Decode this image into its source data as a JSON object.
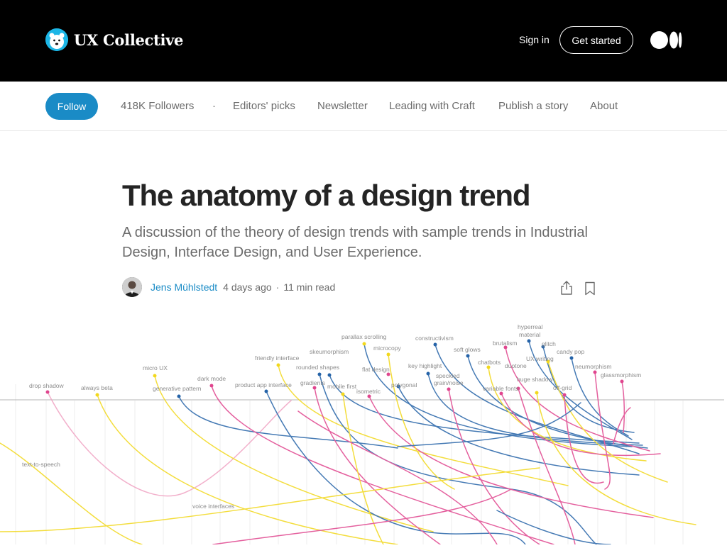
{
  "header": {
    "brand_name": "UX Collective",
    "sign_in": "Sign in",
    "get_started": "Get started"
  },
  "publication_nav": {
    "follow": "Follow",
    "followers": "418K Followers",
    "dot": "·",
    "items": [
      "Editors' picks",
      "Newsletter",
      "Leading with Craft",
      "Publish a story",
      "About"
    ]
  },
  "article": {
    "title": "The anatomy of a design trend",
    "subtitle": "A discussion of the theory of design trends with sample trends in Industrial Design, Interface Design, and User Experience.",
    "author": "Jens Mühlstedt",
    "date": "4 days ago",
    "dot": "·",
    "read_time": "11 min read"
  },
  "hero_chart": {
    "colors": {
      "pink": "#e0458e",
      "yellow": "#f2d81c",
      "blue": "#2563a8",
      "light_pink": "#f0a3c3"
    },
    "labels": [
      "drop shadow",
      "always beta",
      "micro UX",
      "generative pattern",
      "dark mode",
      "friendly interface",
      "product app interface",
      "skeumorphism",
      "rounded shapes",
      "gradients",
      "parallax scrolling",
      "mobile first",
      "microcopy",
      "flat design",
      "isometric",
      "constructivism",
      "key highlight",
      "polygonal",
      "speckled",
      "grain/noise",
      "soft glows",
      "chatbots",
      "brutalism",
      "hyperreal",
      "material",
      "UX writing",
      "duotone",
      "glitch",
      "huge shadow",
      "variable fonts",
      "candy pop",
      "off-grid",
      "neumorphism",
      "glassmorphism",
      "text-to-speech",
      "voice interfaces"
    ]
  }
}
